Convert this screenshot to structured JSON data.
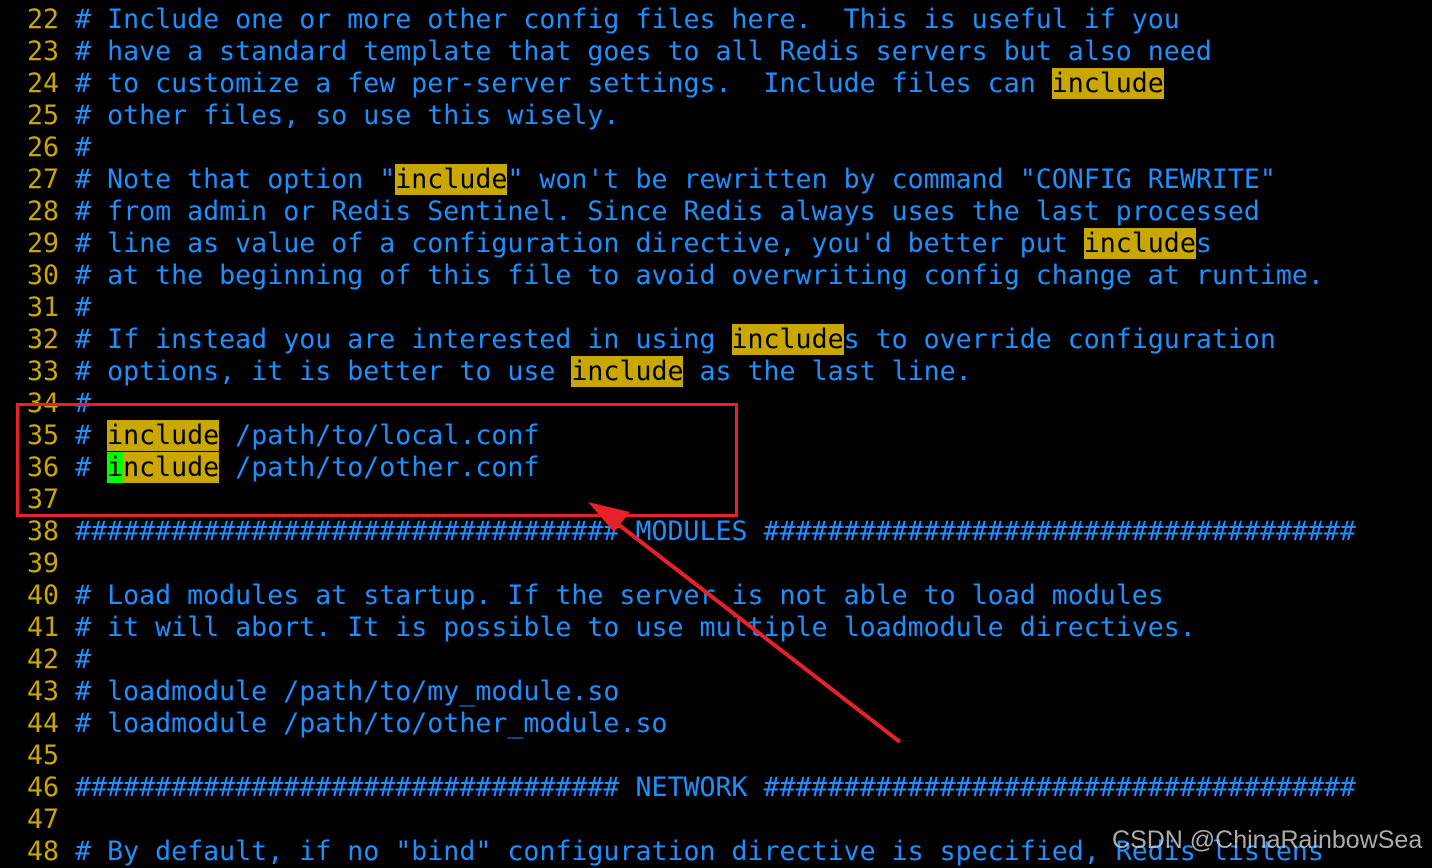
{
  "colors": {
    "text": "#1e8fff",
    "line_number": "#c8a800",
    "search_highlight": "#c8a800",
    "cursor": "#00ff00",
    "annotation": "#e8202a"
  },
  "lines": [
    {
      "n": "22",
      "segs": [
        {
          "t": "# Include one or more other config files here.  This is useful if you"
        }
      ]
    },
    {
      "n": "23",
      "segs": [
        {
          "t": "# have a standard template that goes to all Redis servers but also need"
        }
      ]
    },
    {
      "n": "24",
      "segs": [
        {
          "t": "# to customize a few per-server settings.  Include files can "
        },
        {
          "t": "include",
          "hl": 1
        }
      ]
    },
    {
      "n": "25",
      "segs": [
        {
          "t": "# other files, so use this wisely."
        }
      ]
    },
    {
      "n": "26",
      "segs": [
        {
          "t": "#"
        }
      ]
    },
    {
      "n": "27",
      "segs": [
        {
          "t": "# Note that option \""
        },
        {
          "t": "include",
          "hl": 1
        },
        {
          "t": "\" won't be rewritten by command \"CONFIG REWRITE\""
        }
      ]
    },
    {
      "n": "28",
      "segs": [
        {
          "t": "# from admin or Redis Sentinel. Since Redis always uses the last processed"
        }
      ]
    },
    {
      "n": "29",
      "segs": [
        {
          "t": "# line as value of a configuration directive, you'd better put "
        },
        {
          "t": "include",
          "hl": 1
        },
        {
          "t": "s"
        }
      ]
    },
    {
      "n": "30",
      "segs": [
        {
          "t": "# at the beginning of this file to avoid overwriting config change at runtime."
        }
      ]
    },
    {
      "n": "31",
      "segs": [
        {
          "t": "#"
        }
      ]
    },
    {
      "n": "32",
      "segs": [
        {
          "t": "# If instead you are interested in using "
        },
        {
          "t": "include",
          "hl": 1
        },
        {
          "t": "s to override configuration"
        }
      ]
    },
    {
      "n": "33",
      "segs": [
        {
          "t": "# options, it is better to use "
        },
        {
          "t": "include",
          "hl": 1
        },
        {
          "t": " as the last line."
        }
      ]
    },
    {
      "n": "34",
      "segs": [
        {
          "t": "#"
        }
      ]
    },
    {
      "n": "35",
      "segs": [
        {
          "t": "# "
        },
        {
          "t": "include",
          "hl": 1
        },
        {
          "t": " /path/to/local.conf"
        }
      ]
    },
    {
      "n": "36",
      "segs": [
        {
          "t": "# "
        },
        {
          "t": "i",
          "cur": 1
        },
        {
          "t": "nclude",
          "hl": 1
        },
        {
          "t": " /path/to/other.conf"
        }
      ]
    },
    {
      "n": "37",
      "segs": [
        {
          "t": ""
        }
      ]
    },
    {
      "n": "38",
      "segs": [
        {
          "t": "################################## MODULES #####################################"
        }
      ]
    },
    {
      "n": "39",
      "segs": [
        {
          "t": ""
        }
      ]
    },
    {
      "n": "40",
      "segs": [
        {
          "t": "# Load modules at startup. If the server is not able to load modules"
        }
      ]
    },
    {
      "n": "41",
      "segs": [
        {
          "t": "# it will abort. It is possible to use multiple loadmodule directives."
        }
      ]
    },
    {
      "n": "42",
      "segs": [
        {
          "t": "#"
        }
      ]
    },
    {
      "n": "43",
      "segs": [
        {
          "t": "# loadmodule /path/to/my_module.so"
        }
      ]
    },
    {
      "n": "44",
      "segs": [
        {
          "t": "# loadmodule /path/to/other_module.so"
        }
      ]
    },
    {
      "n": "45",
      "segs": [
        {
          "t": ""
        }
      ]
    },
    {
      "n": "46",
      "segs": [
        {
          "t": "################################## NETWORK #####################################"
        }
      ]
    },
    {
      "n": "47",
      "segs": [
        {
          "t": ""
        }
      ]
    },
    {
      "n": "48",
      "segs": [
        {
          "t": "# By default, if no \"bind\" configuration directive is specified, Redis listens"
        }
      ]
    }
  ],
  "watermark": "CSDN @ChinaRainbowSea"
}
